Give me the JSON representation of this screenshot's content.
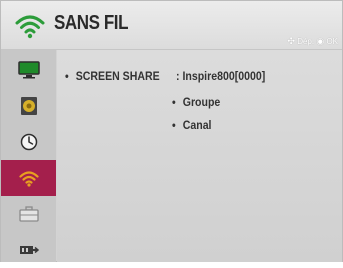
{
  "header": {
    "title": "SANS FIL",
    "icon": "wifi-icon",
    "hints": {
      "move": "Dép.",
      "ok": "OK"
    }
  },
  "sidebar": {
    "items": [
      {
        "icon": "picture-icon",
        "active": false
      },
      {
        "icon": "audio-icon",
        "active": false
      },
      {
        "icon": "clock-icon",
        "active": false
      },
      {
        "icon": "wifi-icon",
        "active": true
      },
      {
        "icon": "option-icon",
        "active": false
      },
      {
        "icon": "input-icon",
        "active": false
      }
    ]
  },
  "main": {
    "screen_share": {
      "label": "SCREEN SHARE",
      "value": ": Inspire800[0000]"
    },
    "options": [
      "Groupe",
      "Canal"
    ]
  },
  "colors": {
    "accent": "#a41f4c",
    "wifi_icon": "#2c9c3a",
    "text": "#333333",
    "background": "#d3d3d3"
  }
}
